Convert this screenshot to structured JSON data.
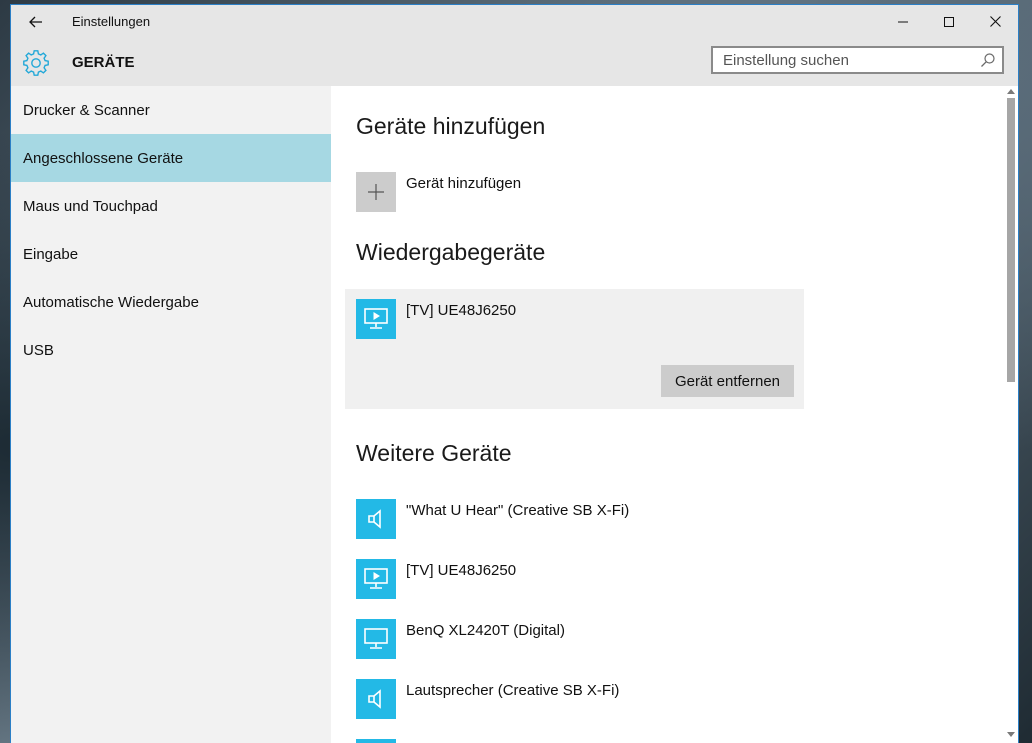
{
  "window": {
    "title": "Einstellungen"
  },
  "header": {
    "page_title": "GERÄTE",
    "search_placeholder": "Einstellung suchen"
  },
  "sidebar": {
    "items": [
      {
        "label": "Drucker & Scanner",
        "active": false
      },
      {
        "label": "Angeschlossene Geräte",
        "active": true
      },
      {
        "label": "Maus und Touchpad",
        "active": false
      },
      {
        "label": "Eingabe",
        "active": false
      },
      {
        "label": "Automatische Wiedergabe",
        "active": false
      },
      {
        "label": "USB",
        "active": false
      }
    ]
  },
  "main": {
    "add_section_title": "Geräte hinzufügen",
    "add_device_label": "Gerät hinzufügen",
    "playback_section_title": "Wiedergabegeräte",
    "playback_devices": [
      {
        "label": "[TV] UE48J6250",
        "icon": "tv-icon"
      }
    ],
    "remove_device_label": "Gerät entfernen",
    "other_section_title": "Weitere Geräte",
    "other_devices": [
      {
        "label": "\"What U Hear\" (Creative SB X-Fi)",
        "icon": "speaker-icon"
      },
      {
        "label": "[TV] UE48J6250",
        "icon": "tv-icon"
      },
      {
        "label": "BenQ XL2420T (Digital)",
        "icon": "monitor-icon"
      },
      {
        "label": "Lautsprecher (Creative SB X-Fi)",
        "icon": "speaker-icon"
      }
    ]
  },
  "colors": {
    "accent": "#23b9e6",
    "sidebar_active": "#a6d8e3",
    "chrome": "#e6e6e6",
    "sidebar_bg": "#f2f2f2"
  }
}
